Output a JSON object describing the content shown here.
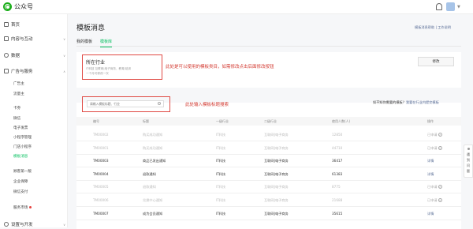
{
  "app": {
    "logo_text": "公众号"
  },
  "sidebar": {
    "home": "首页",
    "content": "内容与互动",
    "data": "数据",
    "ads": "广告与服务",
    "ads_items": [
      "广告主",
      "流量主",
      "卡券",
      "微信",
      "电子发票",
      "小程序管理",
      "门店小程序",
      "模板消息",
      "顾客第一版",
      "企业保障",
      "微信支付"
    ],
    "market": "服务市场",
    "settings": "设置与开发"
  },
  "main": {
    "title": "模板消息",
    "feedback_link": "模板消息帮助 | 工作说明",
    "tabs": [
      {
        "label": "我的模板"
      },
      {
        "label": "模板库"
      }
    ],
    "industry": {
      "title": "所在行业",
      "desc": "IT科技 互联网|电子商务，教育|培训",
      "note": "一个月可修改一次",
      "edit_button": "修改"
    },
    "annotation_industry": "此处是可以使用的模板类目，如需修改点击后面修改按钮",
    "search": {
      "placeholder": "请输入模板标题、行业"
    },
    "annotation_search": "此处输入模板标题搜索",
    "help": {
      "prefix": "如不知你需要的模板？",
      "link": "我要在行业内提交模板"
    },
    "table": {
      "headers": [
        "编号",
        "标题",
        "一级行业",
        "二级行业",
        "使用人数(人)",
        "操作"
      ],
      "rows": [
        {
          "id": "TM00002",
          "title": "购买成功通知",
          "ind1": "IT科技",
          "ind2": "互联网|电子商务",
          "users": "12850",
          "action": "已申请",
          "dim": true
        },
        {
          "id": "TM00001",
          "title": "购买成功通知",
          "ind1": "IT科技",
          "ind2": "互联网|电子商务",
          "users": "44710",
          "action": "已申请",
          "dim": true
        },
        {
          "id": "TM00003",
          "title": "商品已发出通知",
          "ind1": "IT科技",
          "ind2": "互联网|电子商务",
          "users": "36417",
          "action": "详情",
          "dim": false
        },
        {
          "id": "TM00004",
          "title": "退款通知",
          "ind1": "IT科技",
          "ind2": "互联网|电子商务",
          "users": "61383",
          "action": "详情",
          "dim": false
        },
        {
          "id": "TM00005",
          "title": "退款通知",
          "ind1": "IT科技",
          "ind2": "互联网|电子商务",
          "users": "8775",
          "action": "已申请",
          "dim": true
        },
        {
          "id": "TM00006",
          "title": "兑换中心通知",
          "ind1": "IT科技",
          "ind2": "互联网|电子商务",
          "users": "21688",
          "action": "已申请",
          "dim": true
        },
        {
          "id": "TM00007",
          "title": "成为会员通知",
          "ind1": "IT科技",
          "ind2": "互联网|电子商务",
          "users": "35615",
          "action": "详情",
          "dim": false
        }
      ]
    }
  },
  "float_feedback": {
    "chars": [
      "遇",
      "到",
      "问",
      "题"
    ]
  }
}
